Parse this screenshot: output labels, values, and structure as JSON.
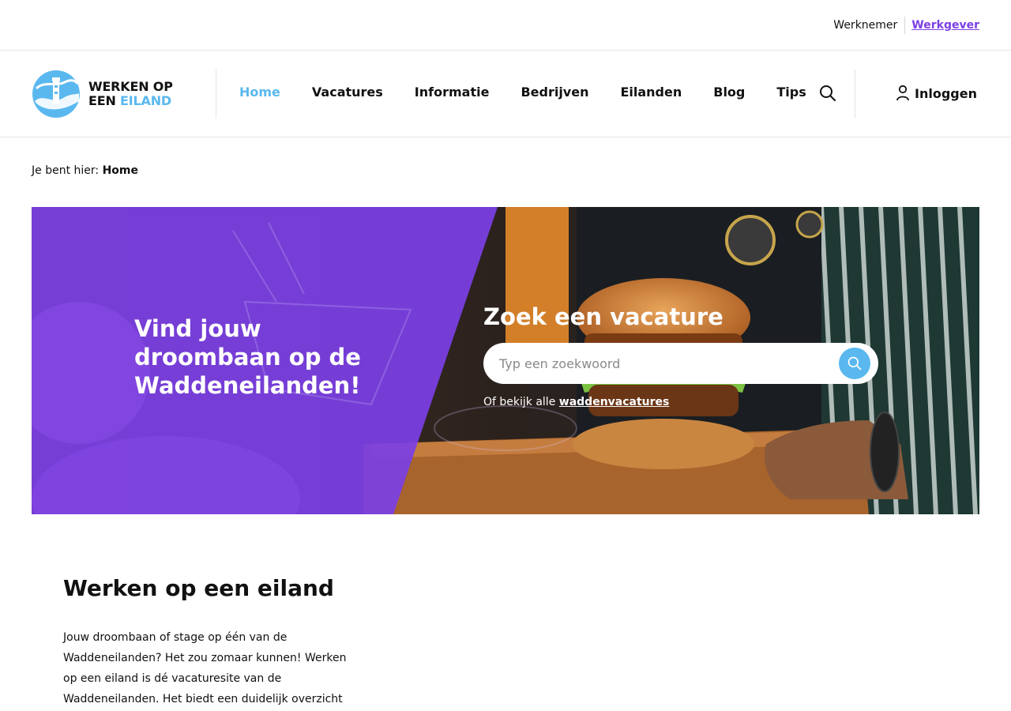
{
  "topbar": {
    "links": [
      {
        "label": "Werknemer"
      },
      {
        "label": "Werkgever"
      }
    ]
  },
  "header": {
    "logo": {
      "line1": "WERKEN OP",
      "line2a": "EEN",
      "line2b": "EILAND"
    },
    "nav": [
      {
        "label": "Home",
        "active": true
      },
      {
        "label": "Vacatures"
      },
      {
        "label": "Informatie"
      },
      {
        "label": "Bedrijven"
      },
      {
        "label": "Eilanden"
      },
      {
        "label": "Blog"
      },
      {
        "label": "Tips"
      }
    ],
    "search_icon": "search-icon",
    "login_label": "Inloggen",
    "login_icon": "user-icon"
  },
  "breadcrumb": {
    "prefix": "Je bent hier:",
    "current": "Home"
  },
  "hero": {
    "title": "Vind jouw droombaan op de Waddeneilanden!",
    "search_title": "Zoek een vacature",
    "search_placeholder": "Typ een zoekwoord",
    "link_prefix": "Of bekijk alle",
    "link_label": "waddenvacatures"
  },
  "intro": {
    "title": "Werken op een eiland",
    "text": "Jouw droombaan of stage op één van de Waddeneilanden? Het zou zomaar kunnen! Werken op een eiland is dé vacaturesite van de Waddeneilanden. Het biedt een duidelijk overzicht"
  },
  "colors": {
    "accent_blue": "#5ab8ef",
    "accent_purple": "#7b3fe4"
  }
}
